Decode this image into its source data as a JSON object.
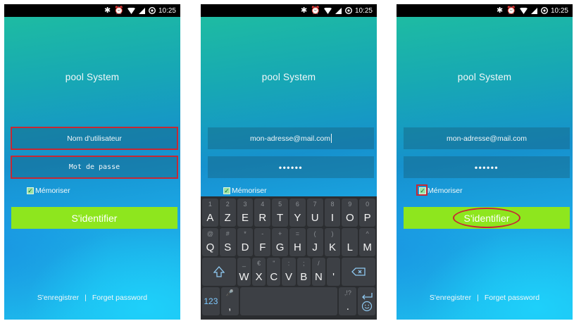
{
  "status_bar": {
    "time": "10:25",
    "icons": [
      "bluetooth-icon",
      "alarm-icon",
      "wifi-icon",
      "signal-icon",
      "data-saver-icon"
    ]
  },
  "app": {
    "title": "pool System"
  },
  "screens": [
    {
      "username_placeholder": "Nom d'utilisateur",
      "password_placeholder": "Mot de passe",
      "remember_label": "Mémoriser",
      "login_label": "S'identifier",
      "register_link": "S'enregistrer",
      "separator": "|",
      "forgot_link": "Forget password"
    },
    {
      "username_value": "mon-adresse@mail.com",
      "password_value": "••••••",
      "remember_label": "Mémoriser"
    },
    {
      "username_value": "mon-adresse@mail.com",
      "password_value": "••••••",
      "remember_label": "Mémoriser",
      "login_label": "S'identifier",
      "register_link": "S'enregistrer",
      "separator": "|",
      "forgot_link": "Forget password"
    }
  ],
  "keyboard": {
    "row1": [
      {
        "label": "A",
        "hint": "1"
      },
      {
        "label": "Z",
        "hint": "2"
      },
      {
        "label": "E",
        "hint": "3"
      },
      {
        "label": "R",
        "hint": "4"
      },
      {
        "label": "T",
        "hint": "5"
      },
      {
        "label": "Y",
        "hint": "6"
      },
      {
        "label": "U",
        "hint": "7"
      },
      {
        "label": "I",
        "hint": "8"
      },
      {
        "label": "O",
        "hint": "9"
      },
      {
        "label": "P",
        "hint": "0"
      }
    ],
    "row2": [
      {
        "label": "Q",
        "hint": "@"
      },
      {
        "label": "S",
        "hint": "#"
      },
      {
        "label": "D",
        "hint": "*"
      },
      {
        "label": "F",
        "hint": "-"
      },
      {
        "label": "G",
        "hint": "+"
      },
      {
        "label": "H",
        "hint": "="
      },
      {
        "label": "J",
        "hint": "("
      },
      {
        "label": "K",
        "hint": ")"
      },
      {
        "label": "L",
        "hint": ""
      },
      {
        "label": "M",
        "hint": "^"
      }
    ],
    "row3": [
      {
        "label": "W",
        "hint": "_"
      },
      {
        "label": "X",
        "hint": "€"
      },
      {
        "label": "C",
        "hint": "\""
      },
      {
        "label": "V",
        "hint": ":"
      },
      {
        "label": "B",
        "hint": ";"
      },
      {
        "label": "N",
        "hint": "/"
      },
      {
        "label": "'",
        "hint": ""
      }
    ],
    "numbers_label": "123",
    "comma_label": ",",
    "comma_hint": "🎤",
    "period_label": ".",
    "period_hint": ",!?"
  },
  "colors": {
    "accent_button": "#8ee61e",
    "highlight": "#c62833",
    "status_bar": "#000000"
  }
}
